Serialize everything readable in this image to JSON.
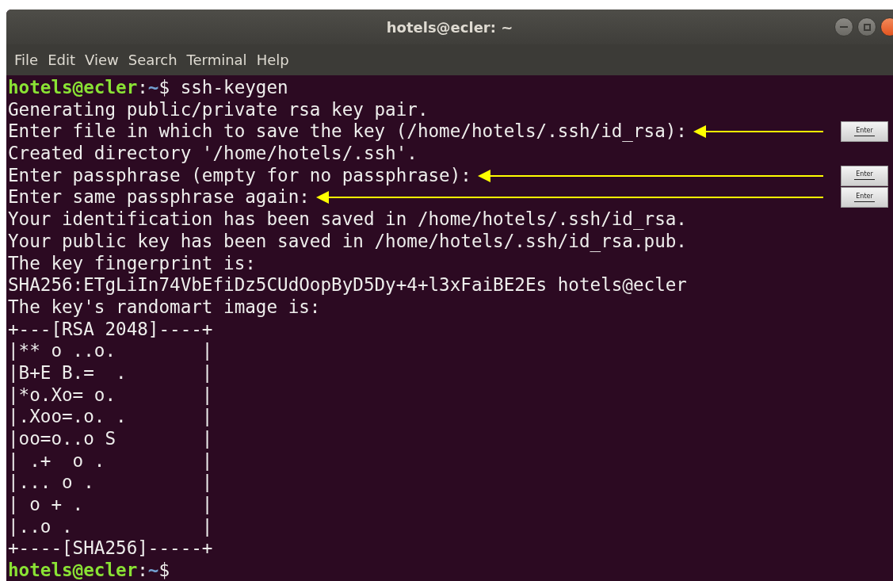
{
  "window": {
    "title": "hotels@ecler: ~"
  },
  "menu": [
    {
      "label": "File"
    },
    {
      "label": "Edit"
    },
    {
      "label": "View"
    },
    {
      "label": "Search"
    },
    {
      "label": "Terminal"
    },
    {
      "label": "Help"
    }
  ],
  "lines": [
    {
      "kind": "prompt",
      "user_host": "hotels@ecler",
      "separator": ":",
      "path": "~",
      "symbol": "$",
      "command": "ssh-keygen"
    },
    {
      "kind": "output",
      "text": "Generating public/private rsa key pair."
    },
    {
      "kind": "output",
      "text": "Enter file in which to save the key (/home/hotels/.ssh/id_rsa):",
      "annotation": {
        "key_label": "Enter"
      }
    },
    {
      "kind": "output",
      "text": "Created directory '/home/hotels/.ssh'."
    },
    {
      "kind": "output",
      "text": "Enter passphrase (empty for no passphrase):",
      "annotation": {
        "key_label": "Enter"
      }
    },
    {
      "kind": "output",
      "text": "Enter same passphrase again:",
      "annotation": {
        "key_label": "Enter"
      }
    },
    {
      "kind": "output",
      "text": "Your identification has been saved in /home/hotels/.ssh/id_rsa."
    },
    {
      "kind": "output",
      "text": "Your public key has been saved in /home/hotels/.ssh/id_rsa.pub."
    },
    {
      "kind": "output",
      "text": "The key fingerprint is:"
    },
    {
      "kind": "output",
      "text": "SHA256:ETgLiIn74VbEfiDz5CUdOopByD5Dy+4+l3xFaiBE2Es hotels@ecler"
    },
    {
      "kind": "output",
      "text": "The key's randomart image is:"
    },
    {
      "kind": "output",
      "text": "+---[RSA 2048]----+"
    },
    {
      "kind": "output",
      "text": "|** o ..o.        |"
    },
    {
      "kind": "output",
      "text": "|B+E B.=  .       |"
    },
    {
      "kind": "output",
      "text": "|*o.Xo= o.        |"
    },
    {
      "kind": "output",
      "text": "|.Xoo=.o. .       |"
    },
    {
      "kind": "output",
      "text": "|oo=o..o S        |"
    },
    {
      "kind": "output",
      "text": "| .+  o .         |"
    },
    {
      "kind": "output",
      "text": "|... o .          |"
    },
    {
      "kind": "output",
      "text": "| o + .           |"
    },
    {
      "kind": "output",
      "text": "|..o .            |"
    },
    {
      "kind": "output",
      "text": "+----[SHA256]-----+"
    },
    {
      "kind": "prompt",
      "user_host": "hotels@ecler",
      "separator": ":",
      "path": "~",
      "symbol": "$"
    }
  ]
}
